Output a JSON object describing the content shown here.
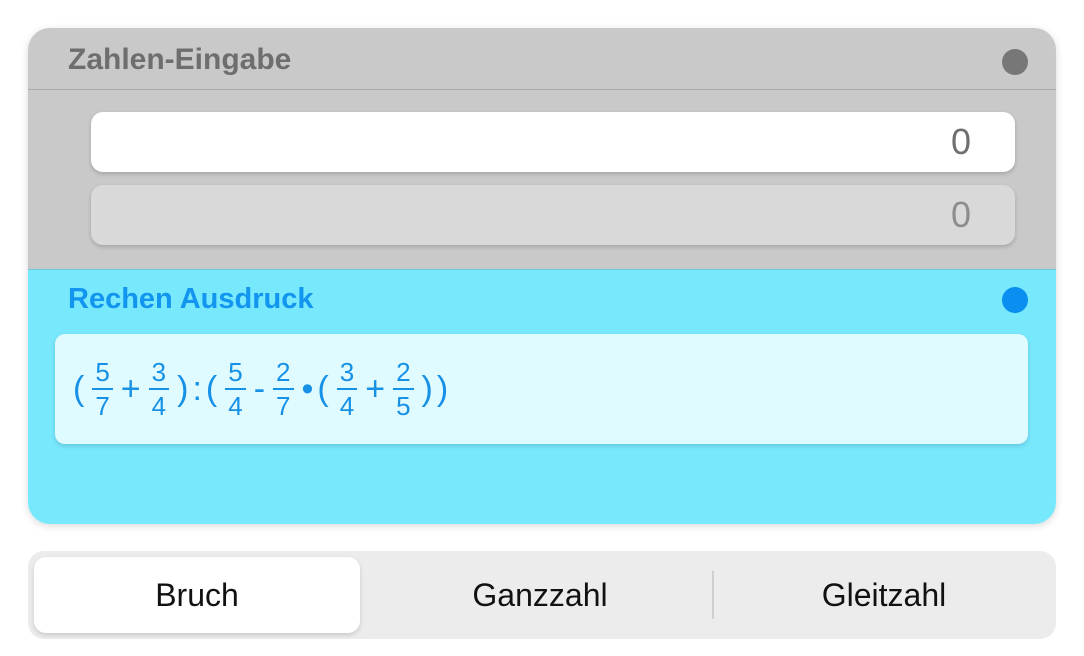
{
  "input_section": {
    "title": "Zahlen-Eingabe",
    "indicator_color": "#777777",
    "field_primary_value": "0",
    "field_secondary_value": "0"
  },
  "expression_section": {
    "title": "Rechen Ausdruck",
    "indicator_color": "#0a8ff0",
    "tokens": {
      "open1": "(",
      "f1_num": "5",
      "f1_den": "7",
      "op_plus1": "+",
      "f2_num": "3",
      "f2_den": "4",
      "close1": ")",
      "op_div": ":",
      "open2": "(",
      "f3_num": "5",
      "f3_den": "4",
      "op_minus": "-",
      "f4_num": "2",
      "f4_den": "7",
      "op_mul": "•",
      "open3": "(",
      "f5_num": "3",
      "f5_den": "4",
      "op_plus2": "+",
      "f6_num": "2",
      "f6_den": "5",
      "close3": ")",
      "close2": ")"
    }
  },
  "mode_selector": {
    "options": [
      "Bruch",
      "Ganzzahl",
      "Gleitzahl"
    ],
    "selected": "Bruch"
  }
}
